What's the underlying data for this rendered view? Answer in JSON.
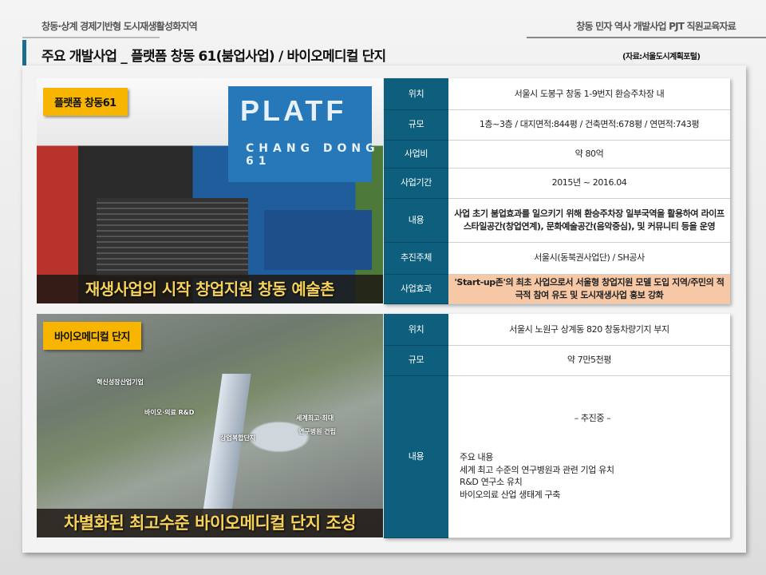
{
  "header": {
    "left": "창동·상계 경제기반형 도시재생활성화지역",
    "right": "창동 민자 역사 개발사업 PJT 직원교육자료"
  },
  "title": "주요 개발사업 _ 플랫폼 창동 61(붐업사업) / 바이오메디컬 단지",
  "source": "(자료:서울도시계획포털)",
  "colors": {
    "accent": "#0e5f7d",
    "badge": "#f7b500",
    "highlight": "#f7c8a6"
  },
  "section1": {
    "badge": "플랫폼 창동61",
    "caption": "재생사업의 시작 창업지원 창동 예술촌",
    "photo_sign": {
      "line1": "PLATF",
      "line2": "CHANG DONG 61"
    },
    "rows": [
      {
        "key": "위치",
        "value": "서울시 도봉구 창동 1-9번지 환승주차장 내"
      },
      {
        "key": "규모",
        "value": "1층~3층 / 대지면적:844평 / 건축면적:678평 / 연면적:743평"
      },
      {
        "key": "사업비",
        "value": "약 80억"
      },
      {
        "key": "사업기간",
        "value": "2015년 ~ 2016.04"
      },
      {
        "key": "내용",
        "value": "사업 초기 붐업효과를 일으키기 위해 환승주차장 일부국역을 활용하여 라이프스타일공간(창업연계), 문화예술공간(음악중심), 및 커뮤니티 등을 운영"
      },
      {
        "key": "추진주체",
        "value": "서울시(동북권사업단) / SH공사"
      },
      {
        "key": "사업효과",
        "value": "'Start-up존'의 최초 사업으로서 서울형 창업지원 모델 도입 지역/주민의 적극적 참여 유도 및 도시재생사업 홍보 강화"
      }
    ]
  },
  "section2": {
    "badge": "바이오메디컬 단지",
    "caption": "차별화된 최고수준 바이오메디컬 단지 조성",
    "photo_labels": [
      "혁신성장산업기업",
      "바이오·의료 R&D",
      "상업복합단지",
      "세계최고·최대",
      "연구병원 건립"
    ],
    "rows": [
      {
        "key": "위치",
        "value": "서울시 노원구 상계동 820 창동차량기지 부지"
      },
      {
        "key": "규모",
        "value": "약 7만5천평"
      },
      {
        "key": "내용",
        "status": "– 추진중 –",
        "items": [
          "주요 내용",
          "세계 최고 수준의 연구병원과 관련 기업 유치",
          "R&D 연구소 유치",
          "바이오의료 산업 생태계 구축"
        ]
      }
    ]
  }
}
